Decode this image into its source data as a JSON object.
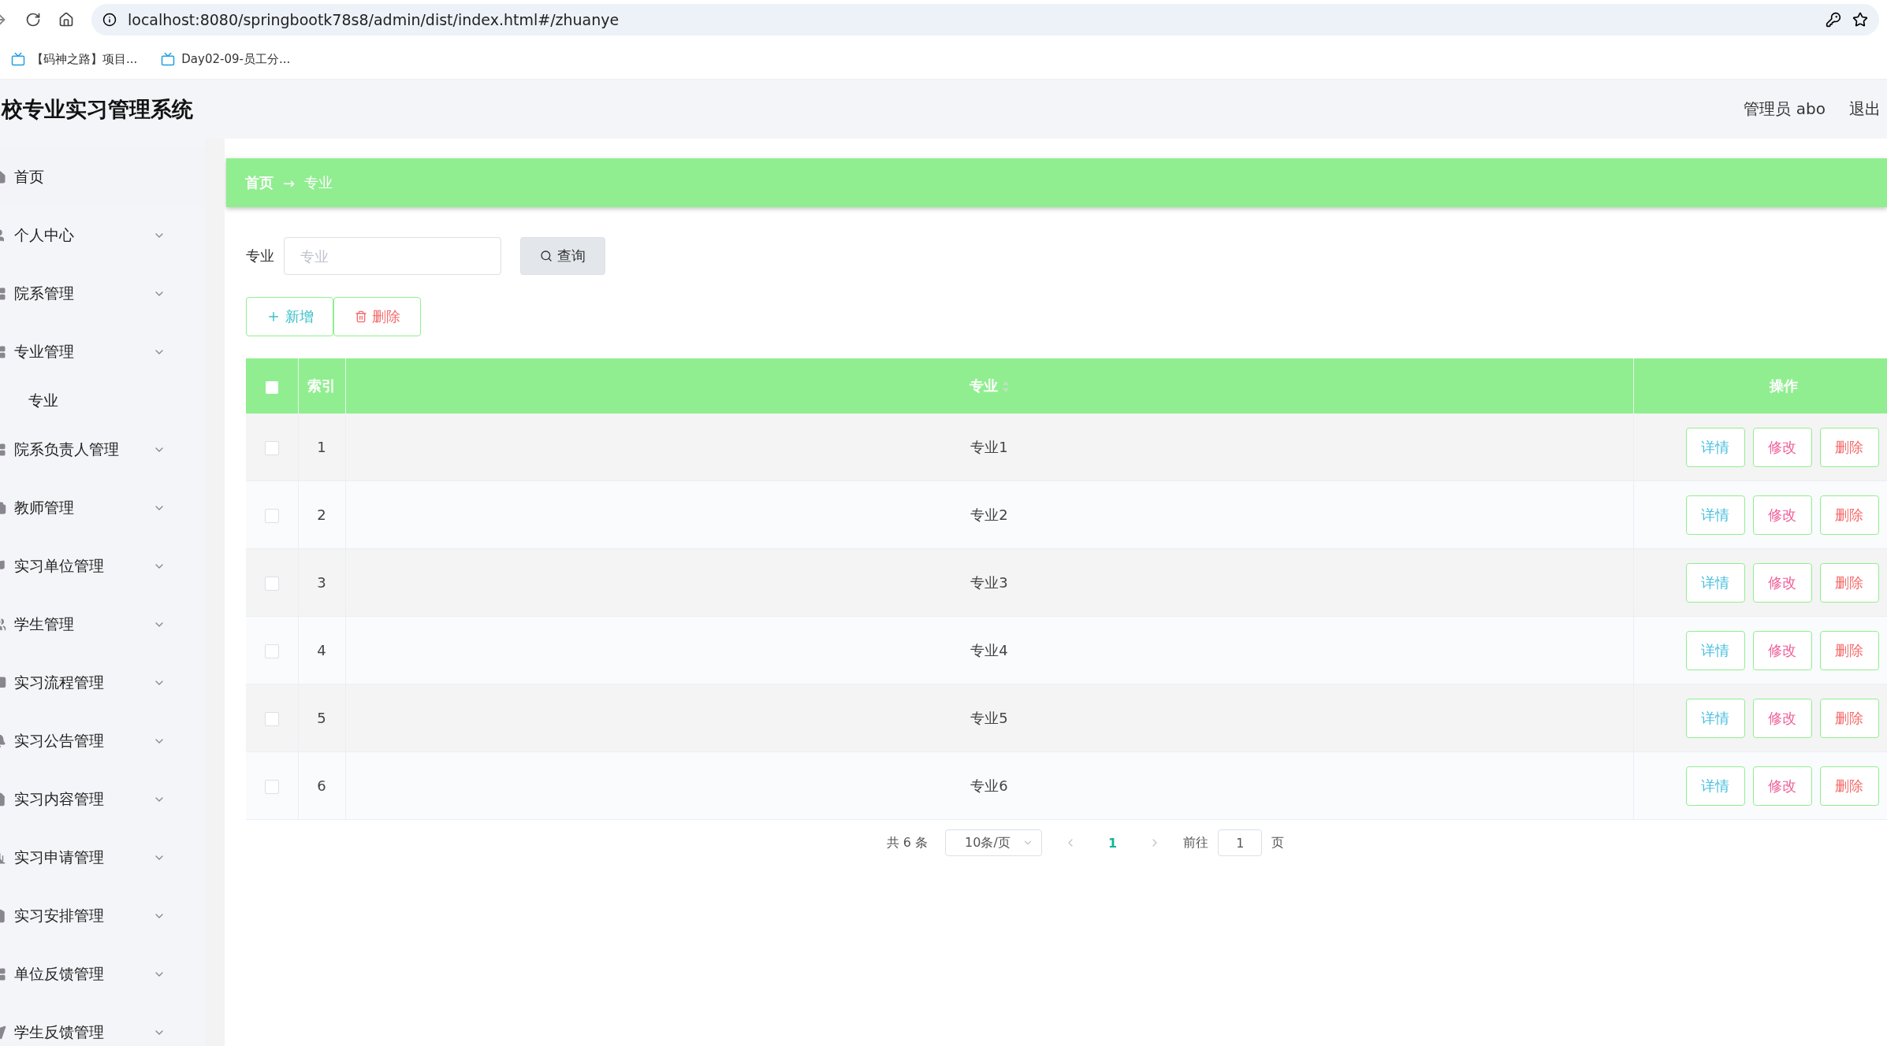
{
  "browser": {
    "url": "localhost:8080/springbootk78s8/admin/dist/index.html#/zhuanye",
    "bookmarks": [
      "【码神之路】项目...",
      "Day02-09-员工分..."
    ]
  },
  "header": {
    "title": "校专业实习管理系统",
    "user": "管理员 abo",
    "logout": "退出"
  },
  "sidebar": {
    "items": [
      {
        "label": "首页",
        "kind": "link"
      },
      {
        "label": "个人中心",
        "kind": "menu"
      },
      {
        "label": "院系管理",
        "kind": "menu"
      },
      {
        "label": "专业管理",
        "kind": "menu",
        "children": [
          {
            "label": "专业"
          }
        ]
      },
      {
        "label": "院系负责人管理",
        "kind": "menu"
      },
      {
        "label": "教师管理",
        "kind": "menu"
      },
      {
        "label": "实习单位管理",
        "kind": "menu"
      },
      {
        "label": "学生管理",
        "kind": "menu"
      },
      {
        "label": "实习流程管理",
        "kind": "menu"
      },
      {
        "label": "实习公告管理",
        "kind": "menu"
      },
      {
        "label": "实习内容管理",
        "kind": "menu"
      },
      {
        "label": "实习申请管理",
        "kind": "menu"
      },
      {
        "label": "实习安排管理",
        "kind": "menu"
      },
      {
        "label": "单位反馈管理",
        "kind": "menu"
      },
      {
        "label": "学生反馈管理",
        "kind": "menu"
      }
    ]
  },
  "breadcrumb": {
    "home": "首页",
    "separator": "→",
    "current": "专业"
  },
  "search": {
    "label": "专业",
    "placeholder": "专业",
    "button": "查询"
  },
  "actions": {
    "add": "新增",
    "delete": "删除"
  },
  "table": {
    "select_all_checked": false,
    "columns": [
      {
        "label": "索引"
      },
      {
        "label": "专业"
      },
      {
        "label": "操作"
      }
    ],
    "rows": [
      {
        "index": "1",
        "name": "专业1",
        "checked": false,
        "actions": [
          "详情",
          "修改",
          "删除"
        ]
      },
      {
        "index": "2",
        "name": "专业2",
        "checked": false,
        "actions": [
          "详情",
          "修改",
          "删除"
        ]
      },
      {
        "index": "3",
        "name": "专业3",
        "checked": false,
        "actions": [
          "详情",
          "修改",
          "删除"
        ]
      },
      {
        "index": "4",
        "name": "专业4",
        "checked": false,
        "actions": [
          "详情",
          "修改",
          "删除"
        ]
      },
      {
        "index": "5",
        "name": "专业5",
        "checked": false,
        "actions": [
          "详情",
          "修改",
          "删除"
        ]
      },
      {
        "index": "6",
        "name": "专业6",
        "checked": false,
        "actions": [
          "详情",
          "修改",
          "删除"
        ]
      }
    ]
  },
  "pagination": {
    "total": "共 6 条",
    "page_size": "10条/页",
    "current": "1",
    "goto_label": "前往",
    "goto_value": "1",
    "goto_suffix": "页"
  }
}
